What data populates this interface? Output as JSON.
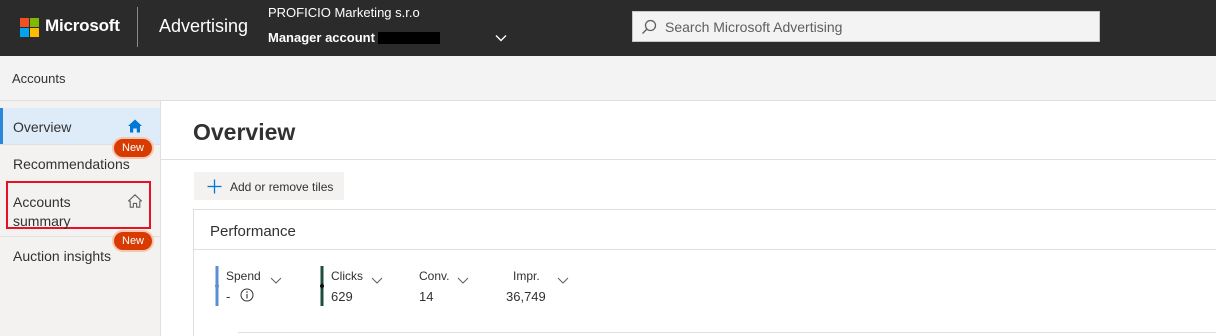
{
  "header": {
    "brand": "Microsoft",
    "product": "Advertising",
    "account_name": "PROFICIO Marketing s.r.o",
    "account_type": "Manager account",
    "search_placeholder": "Search Microsoft Advertising",
    "logo_colors": [
      "#f25022",
      "#7fba00",
      "#00a4ef",
      "#ffb900"
    ]
  },
  "breadcrumb": {
    "label": "Accounts"
  },
  "sidebar": {
    "items": [
      {
        "label": "Overview",
        "icon": "home-filled-icon",
        "selected": true
      },
      {
        "label": "Recommendations",
        "badge": "New"
      },
      {
        "label": "Accounts summary",
        "icon": "home-outline-icon",
        "highlighted": true
      },
      {
        "label": "Auction insights",
        "badge": "New"
      }
    ]
  },
  "main": {
    "title": "Overview",
    "add_tiles_label": "Add or remove tiles",
    "performance": {
      "title": "Performance",
      "metrics": [
        {
          "name": "Spend",
          "value": "-",
          "color": "#5b8fd1",
          "info_icon": "info-icon"
        },
        {
          "name": "Clicks",
          "value": "629",
          "color": "#1f4e3d"
        },
        {
          "name": "Conv.",
          "value": "14"
        },
        {
          "name": "Impr.",
          "value": "36,749"
        }
      ]
    }
  },
  "colors": {
    "accent": "#0078d4",
    "badge": "#d83b01",
    "highlight_border": "#e81123"
  }
}
